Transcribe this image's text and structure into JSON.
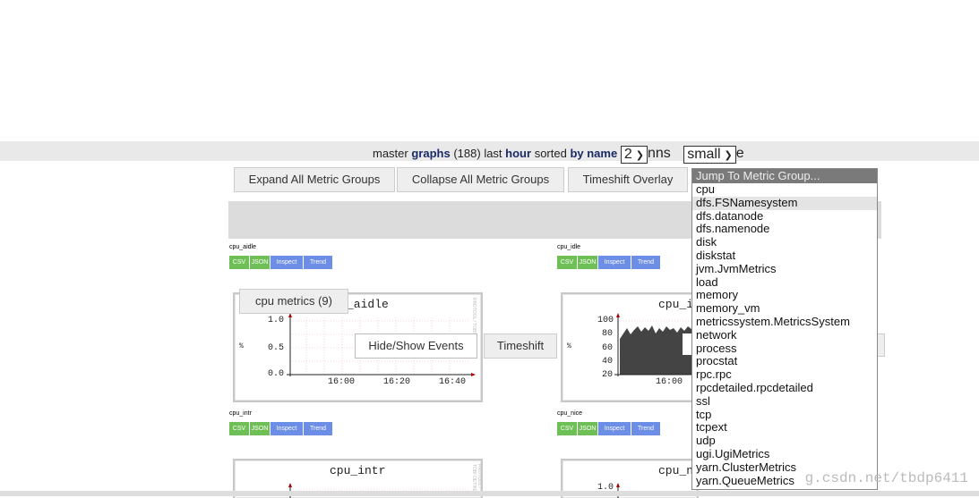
{
  "header": {
    "prefix": "master",
    "graphs_word": "graphs",
    "count": "(188)",
    "last_word": "last",
    "hour_word": "hour",
    "sorted_word": "sorted",
    "byname_word": "by name",
    "columns_value": "2",
    "columns_suffix": "nns",
    "size_value": "small",
    "size_suffix": "e"
  },
  "toolbar": {
    "expand": "Expand All Metric Groups",
    "collapse": "Collapse All Metric Groups",
    "timeshift_overlay": "Timeshift Overlay"
  },
  "dropdown": {
    "header": "Jump To Metric Group...",
    "items": [
      "cpu",
      "dfs.FSNamesystem",
      "dfs.datanode",
      "dfs.namenode",
      "disk",
      "diskstat",
      "jvm.JvmMetrics",
      "load",
      "memory",
      "memory_vm",
      "metricssystem.MetricsSystem",
      "network",
      "process",
      "procstat",
      "rpc.rpc",
      "rpcdetailed.rpcdetailed",
      "ssl",
      "tcp",
      "tcpext",
      "udp",
      "ugi.UgiMetrics",
      "yarn.ClusterMetrics",
      "yarn.QueueMetrics"
    ],
    "highlighted": "dfs.FSNamesystem"
  },
  "tags": {
    "csv": "CSV",
    "json": "JSON",
    "inspect": "Inspect",
    "trend": "Trend"
  },
  "metric_group": {
    "label": "cpu metrics (9)"
  },
  "overlay_buttons": {
    "hide_show_events": "Hide/Show Events",
    "timeshift": "Timeshift"
  },
  "graphs": {
    "cpu_aidle": {
      "name": "cpu_aidle",
      "title_visible": "_aidle",
      "ylabel": "%",
      "yticks": [
        "1.0",
        "0.5",
        "0.0"
      ],
      "xticks": [
        "16:00",
        "16:20",
        "16:40"
      ]
    },
    "cpu_idle": {
      "name": "cpu_idle",
      "title_visible": "cpu_i",
      "ylabel": "%",
      "yticks": [
        "100",
        "80",
        "60",
        "40",
        "20"
      ],
      "xticks": [
        "16:00"
      ]
    },
    "cpu_intr": {
      "name": "cpu_intr",
      "title_visible": "cpu_intr"
    },
    "cpu_nice": {
      "name": "cpu_nice",
      "title_visible": "cpu_n",
      "ytick": "1.0"
    }
  },
  "side_text": {
    "rrdtool": "RRDTOOL / TOBI OETIKER"
  },
  "watermark": "g.csdn.net/tbdp6411"
}
